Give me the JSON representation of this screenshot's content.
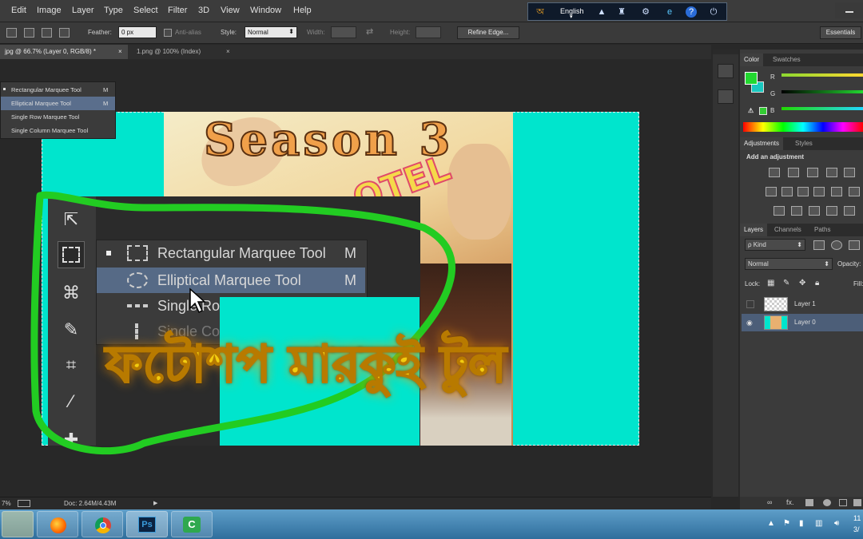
{
  "menu": [
    "Edit",
    "Image",
    "Layer",
    "Type",
    "Select",
    "Filter",
    "3D",
    "View",
    "Window",
    "Help"
  ],
  "language_bar": {
    "language": "English",
    "chevron": "▾"
  },
  "options": {
    "feather_label": "Feather:",
    "feather_value": "0 px",
    "antialias_label": "Anti-alias",
    "style_label": "Style:",
    "style_value": "Normal",
    "width_label": "Width:",
    "height_label": "Height:",
    "refine_label": "Refine Edge...",
    "workspace": "Essentials"
  },
  "tabs": [
    {
      "label": "jpg @ 66.7% (Layer 0, RGB/8) *",
      "close": "×"
    },
    {
      "label": "1.png @ 100% (Index)",
      "close": "×"
    }
  ],
  "flyout_small": [
    {
      "name": "Rectangular Marquee Tool",
      "key": "M"
    },
    {
      "name": "Elliptical Marquee Tool",
      "key": "M"
    },
    {
      "name": "Single Row Marquee Tool",
      "key": ""
    },
    {
      "name": "Single Column Marquee Tool",
      "key": ""
    }
  ],
  "flyout_zoom": [
    {
      "name": "Rectangular Marquee Tool",
      "key": "M"
    },
    {
      "name": "Elliptical Marquee Tool",
      "key": "M"
    },
    {
      "name": "Single Row Marquee Tool",
      "key": ""
    },
    {
      "name": "Single Column Marquee Tool",
      "key": ""
    }
  ],
  "overlay": {
    "season": "Season 3",
    "bengali": "ফটোশপ মারকুই টুল",
    "hotel": "OTEL"
  },
  "status": {
    "zoom": "7%",
    "doc": "Doc: 2.64M/4.43M"
  },
  "color_panel": {
    "tabs": [
      "Color",
      "Swatches"
    ],
    "labels": [
      "R",
      "G",
      "B"
    ],
    "fg": "#22d830",
    "bg": "#19c8c0"
  },
  "adjustments": {
    "tabs": [
      "Adjustments",
      "Styles"
    ],
    "title": "Add an adjustment"
  },
  "layers_panel": {
    "tabs": [
      "Layers",
      "Channels",
      "Paths"
    ],
    "kind": "ρ Kind",
    "blend": "Normal",
    "opacity_label": "Opacity:",
    "lock_label": "Lock:",
    "fill_label": "Fill:",
    "layers": [
      {
        "name": "Layer 1",
        "visible": false
      },
      {
        "name": "Layer 0",
        "visible": true
      }
    ]
  },
  "bottom_icons": [
    "∞",
    "fx."
  ],
  "taskbar": {
    "time": "11",
    "date": "3/"
  }
}
